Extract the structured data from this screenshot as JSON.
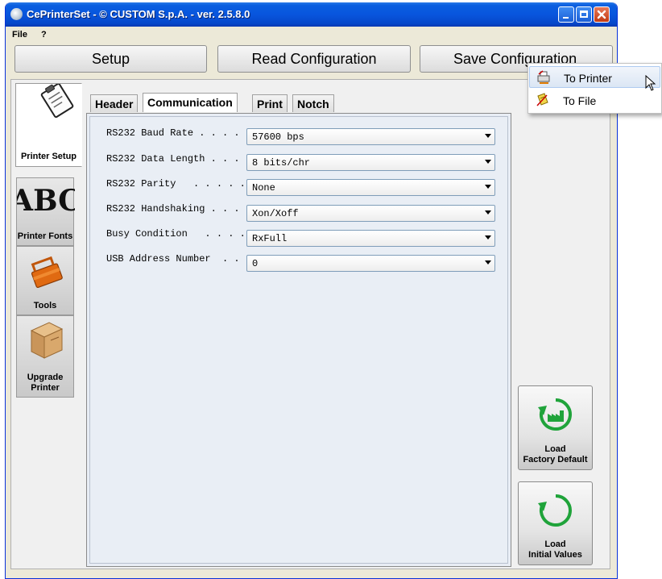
{
  "window": {
    "title": "CePrinterSet - © CUSTOM S.p.A. - ver. 2.5.8.0"
  },
  "menu": {
    "items": [
      "File",
      "?"
    ]
  },
  "toolbar": {
    "setup": "Setup",
    "read": "Read Configuration",
    "save": "Save Configuration"
  },
  "sidebar": {
    "tabs": [
      {
        "label": "Printer Setup",
        "icon": "clipboard-icon",
        "active": true
      },
      {
        "label": "Printer Fonts",
        "icon": "abc-font-icon",
        "active": false
      },
      {
        "label": "Tools",
        "icon": "toolbox-icon",
        "active": false
      },
      {
        "label": "Upgrade Printer",
        "icon": "package-box-icon",
        "active": false
      }
    ]
  },
  "inner_tabs": [
    "Header",
    "Communication",
    "Print",
    "Notch"
  ],
  "inner_tab_active": "Communication",
  "settings": [
    {
      "label": "RS232 Baud Rate . . . .",
      "value": "57600 bps"
    },
    {
      "label": "RS232 Data Length . . .",
      "value": "8 bits/chr"
    },
    {
      "label": "RS232 Parity   . . . . .",
      "value": "None"
    },
    {
      "label": "RS232 Handshaking . . .",
      "value": "Xon/Xoff"
    },
    {
      "label": "Busy Condition   . . . .",
      "value": "RxFull"
    },
    {
      "label": "USB Address Number  . .",
      "value": "0"
    }
  ],
  "actions": {
    "factory_default": {
      "line1": "Load",
      "line2": "Factory Default"
    },
    "initial_values": {
      "line1": "Load",
      "line2": "Initial Values"
    }
  },
  "save_menu": {
    "items": [
      "To Printer",
      "To File"
    ],
    "hovered": "To Printer"
  },
  "colors": {
    "titlebar": "#0855dd",
    "accent_green": "#1fa33a",
    "config_bg": "#e9eef5"
  }
}
